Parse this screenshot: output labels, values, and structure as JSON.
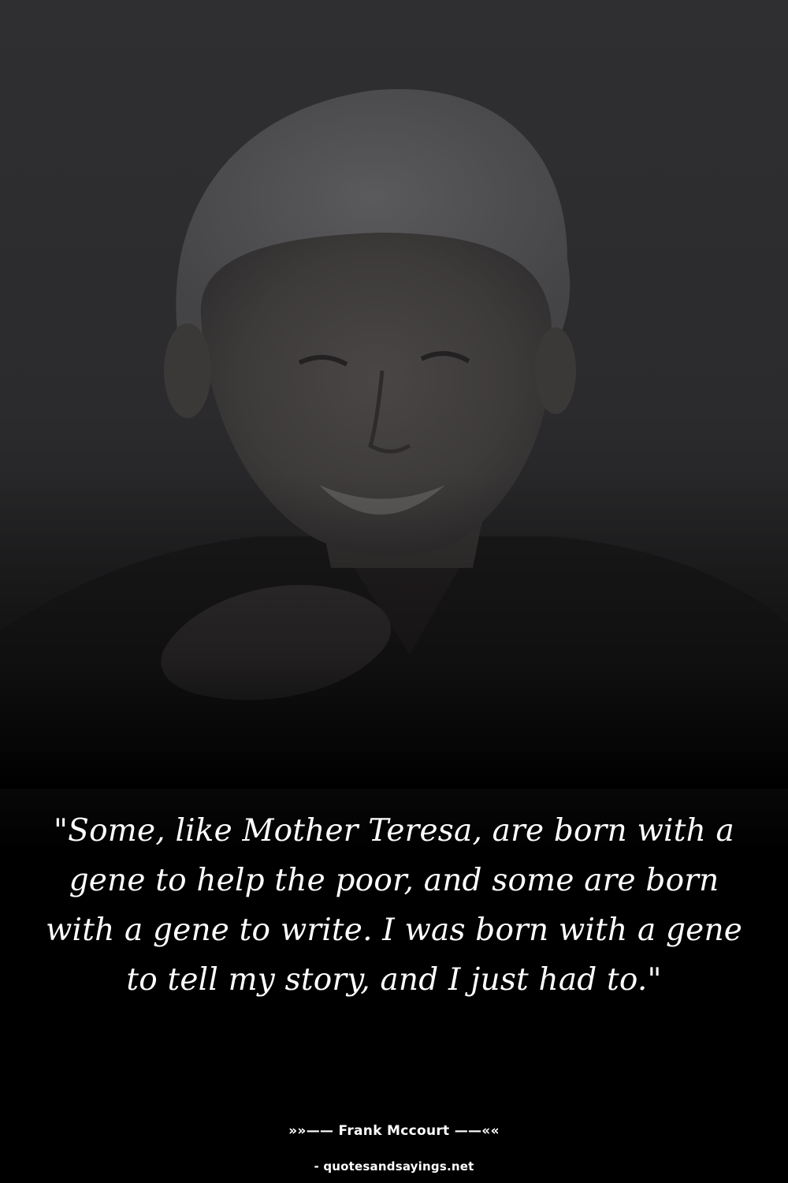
{
  "quote": {
    "text": "\"Some, like Mother Teresa, are born with a gene to help the poor, and some are born with a gene to write. I was born with a gene to tell my story, and I just had to.\""
  },
  "attribution": {
    "author_line": "»»—— Frank Mccourt ——««",
    "source": "- quotesandsayings.net"
  },
  "portrait": {
    "subject": "smiling-older-man-portrait",
    "tint": "#2d2d2f"
  }
}
